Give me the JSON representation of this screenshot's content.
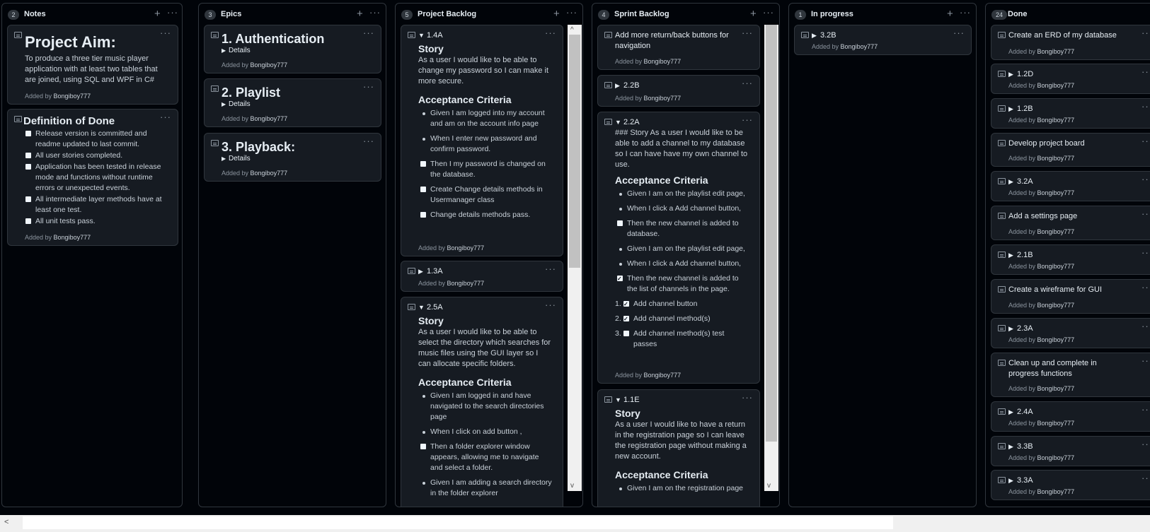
{
  "columns": {
    "notes": {
      "count": "2",
      "title": "Notes"
    },
    "epics": {
      "count": "3",
      "title": "Epics"
    },
    "project_backlog": {
      "count": "5",
      "title": "Project Backlog"
    },
    "sprint_backlog": {
      "count": "4",
      "title": "Sprint Backlog"
    },
    "in_progress": {
      "count": "1",
      "title": "In progress"
    },
    "done": {
      "count": "24",
      "title": "Done"
    }
  },
  "icons": {
    "add": "+",
    "menu": "···",
    "caret_right": "▶",
    "caret_down": "▼",
    "scroll_up": "^",
    "scroll_down": "v",
    "scroll_left": "<"
  },
  "added_prefix": "Added by",
  "author": "Bongiboy777",
  "notes": {
    "aim_title": "Project Aim:",
    "aim_text": "To produce a three tier music player application with at least two tables that are joined, using SQL and WPF in C#",
    "dod_title": "Definition of Done",
    "dod_items": [
      "Release version is committed and readme updated to last commit.",
      "All user stories completed.",
      "Application has been tested in release mode and functions without runtime errors or unexpected events.",
      "All intermediate layer methods have at least one test.",
      "All unit tests pass."
    ]
  },
  "epics": {
    "items": [
      "1. Authentication",
      "2. Playlist",
      "3. Playback:"
    ],
    "details": "Details"
  },
  "backlog": {
    "c1_title": "1.4A",
    "story_heading": "Story",
    "c1_story": "As a user I would like to be able to change my password so I can make it more secure.",
    "ac_heading": "Acceptance Criteria",
    "c1_items": [
      "Given I am logged into my account and am on the account info page",
      "When I enter new password and confirm password.",
      "Then I my password is changed on the database.",
      "Create Change details methods in Usermanager class",
      "Change details methods pass."
    ],
    "c2_title": "1.3A",
    "c3_title": "2.5A",
    "c3_story": "As a user I would like to be able to select the directory which searches for music files using the GUI layer so I can allocate specific folders.",
    "c3_items": [
      "Given I am logged in and have navigated to the search directories page",
      "When I click on add button ,",
      "Then a folder explorer window appears, allowing me to navigate and select a folder.",
      "Given I am adding a search directory in the folder explorer"
    ]
  },
  "sprint": {
    "c1_title": "Add more return/back buttons for navigation",
    "c2_title": "2.2B",
    "c3_title": "2.2A",
    "c3_story": "### Story As a user I would like to be able to add a channel to my database so I can have have my own channel to use.",
    "ac_heading": "Acceptance Criteria",
    "c3_items": [
      "Given I am on the playlist edit page,",
      "When I click a Add channel button,",
      "Then the new channel is added to database.",
      "Given I am on the playlist edit page,",
      "When I click a Add channel button,",
      "Then the new channel is added to the list of channels in the page."
    ],
    "c3_numbered": [
      "Add channel button",
      "Add channel method(s)",
      "Add channel method(s) test passes"
    ],
    "num_labels": [
      "1.",
      "2.",
      "3."
    ],
    "c4_title": "1.1E",
    "story_heading": "Story",
    "c4_story": "As a user I would like to have a return in the registration page so I can leave the registration page without making a new account.",
    "c4_items": [
      "Given I am on the registration page"
    ]
  },
  "in_progress": {
    "c1_title": "3.2B"
  },
  "done": {
    "items": [
      {
        "title": "Create an ERD of my database",
        "caret": false
      },
      {
        "title": "1.2D",
        "caret": true
      },
      {
        "title": "1.2B",
        "caret": true
      },
      {
        "title": "Develop project board",
        "caret": false
      },
      {
        "title": "3.2A",
        "caret": true
      },
      {
        "title": "Add a settings page",
        "caret": false
      },
      {
        "title": "2.1B",
        "caret": true
      },
      {
        "title": "Create a wireframe for GUI",
        "caret": false
      },
      {
        "title": "2.3A",
        "caret": true
      },
      {
        "title": "Clean up and complete in progress functions",
        "caret": false
      },
      {
        "title": "2.4A",
        "caret": true
      },
      {
        "title": "3.3B",
        "caret": true
      },
      {
        "title": "3.3A",
        "caret": true
      }
    ]
  },
  "scroll": {
    "backlog_position": 0.0,
    "sprint_position": 0.0,
    "horizontal_position": 0.0
  }
}
